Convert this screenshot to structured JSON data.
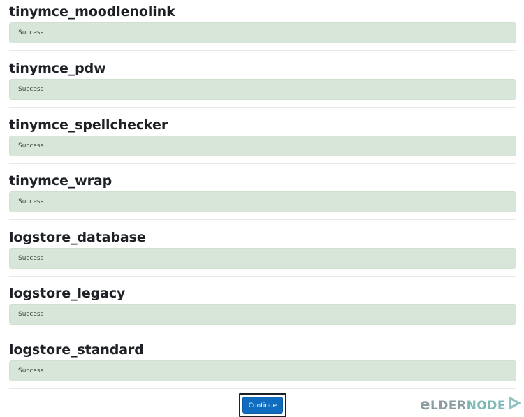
{
  "sections": [
    {
      "title": "tinymce_moodlenolink",
      "status": "Success"
    },
    {
      "title": "tinymce_pdw",
      "status": "Success"
    },
    {
      "title": "tinymce_spellchecker",
      "status": "Success"
    },
    {
      "title": "tinymce_wrap",
      "status": "Success"
    },
    {
      "title": "logstore_database",
      "status": "Success"
    },
    {
      "title": "logstore_legacy",
      "status": "Success"
    },
    {
      "title": "logstore_standard",
      "status": "Success"
    }
  ],
  "actions": {
    "continue_label": "Continue"
  },
  "watermark": {
    "text_e": "e",
    "text_lder": "lder",
    "text_node": "node",
    "icon": "play-arrow-icon"
  },
  "colors": {
    "success_bg": "#d7e6d8",
    "primary_button": "#0f6cbf",
    "logo_gray": "#8a9ba2",
    "logo_teal": "#7cb8b6"
  }
}
